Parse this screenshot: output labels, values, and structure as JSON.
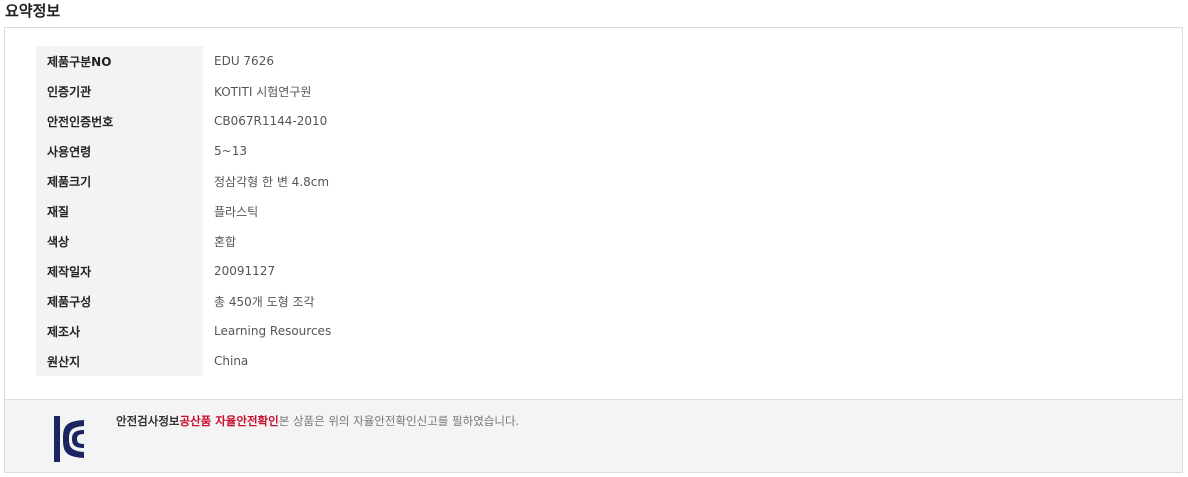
{
  "title": "요약정보",
  "specs": [
    {
      "label": "제품구분NO",
      "value": "EDU 7626"
    },
    {
      "label": "인증기관",
      "value": "KOTITI 시험연구원"
    },
    {
      "label": "안전인증번호",
      "value": "CB067R1144-2010"
    },
    {
      "label": "사용연령",
      "value": "5~13"
    },
    {
      "label": "제품크기",
      "value": "정삼각형 한 변 4.8cm"
    },
    {
      "label": "재질",
      "value": "플라스틱"
    },
    {
      "label": "색상",
      "value": "혼합"
    },
    {
      "label": "제작일자",
      "value": "20091127"
    },
    {
      "label": "제품구성",
      "value": "총 450개 도형 조각"
    },
    {
      "label": "제조사",
      "value": "Learning Resources"
    },
    {
      "label": "원산지",
      "value": "China"
    }
  ],
  "safety": {
    "label": "안전검사정보",
    "category": "공산품 자율안전확인",
    "text": "본 상품은 위의 자율안전확인신고를 필하였습니다.",
    "logo_icon": "kc-certification-mark",
    "logo_color": "#1c2563",
    "category_color": "#c8102e"
  }
}
